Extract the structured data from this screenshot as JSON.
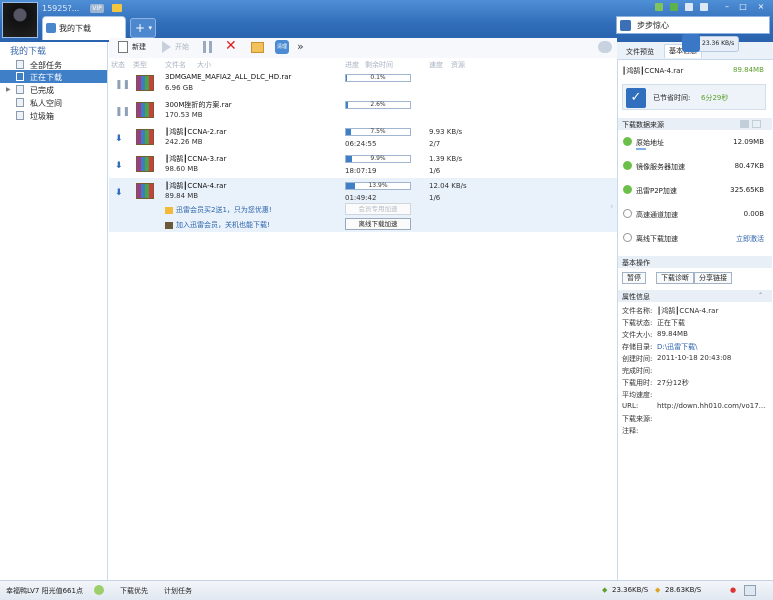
{
  "titlebar": {
    "username": "15925?...",
    "vip": "VIP",
    "tab_label": "我的下载",
    "new_tab": "+",
    "search_text": "步步惊心"
  },
  "sidebar": {
    "title": "我的下载",
    "items": [
      {
        "label": "全部任务"
      },
      {
        "label": "正在下载"
      },
      {
        "label": "已完成"
      },
      {
        "label": "私人空间"
      },
      {
        "label": "垃圾箱"
      }
    ]
  },
  "toolbar": {
    "new": "新建",
    "start": "开始",
    "more": "»",
    "clear_label": "清理"
  },
  "columns": {
    "state": "状态",
    "type": "类型",
    "filename": "文件名",
    "size": "大小",
    "progress": "进度",
    "remaining": "剩余时间",
    "speed": "速度",
    "resource": "资源"
  },
  "tasks": [
    {
      "name": "3DMGAME_MAFIA2_ALL_DLC_HD.rar",
      "size": "6.96 GB",
      "progress_text": "0.1%",
      "progress": 0.001,
      "remaining": "",
      "speed": "",
      "conn": "",
      "state": "paused"
    },
    {
      "name": "300M挫折的方案.rar",
      "size": "170.53 MB",
      "progress_text": "2.6%",
      "progress": 0.026,
      "remaining": "",
      "speed": "",
      "conn": "",
      "state": "paused"
    },
    {
      "name": "┃鸿鹄┃CCNA-2.rar",
      "size": "242.26 MB",
      "progress_text": "7.5%",
      "progress": 0.075,
      "remaining": "06:24:55",
      "speed": "9.93 KB/s",
      "conn": "2/7",
      "state": "downloading"
    },
    {
      "name": "┃鸿鹄┃CCNA-3.rar",
      "size": "98.60 MB",
      "progress_text": "9.9%",
      "progress": 0.099,
      "remaining": "18:07:19",
      "speed": "1.39 KB/s",
      "conn": "1/6",
      "state": "downloading"
    },
    {
      "name": "┃鸿鹄┃CCNA-4.rar",
      "size": "89.84 MB",
      "progress_text": "13.9%",
      "progress": 0.139,
      "remaining": "01:49:42",
      "speed": "12.04 KB/s",
      "conn": "1/6",
      "state": "downloading"
    }
  ],
  "promo": {
    "line1": "迅雷会员买2送1，只为您优惠!",
    "line2": "加入迅雷会员，关机也能下载!",
    "btn_vip_accel": "会员专用加速",
    "btn_offline": "离线下载加速"
  },
  "right_panel": {
    "tab_preview": "文件预览",
    "tab_info": "基本信息",
    "speed_popup": "23.36 KB/s",
    "file_line": "┃鸿鹄┃CCNA-4.rar",
    "file_size": "89.84MB",
    "saved_label": "已节省时间:",
    "saved_value": "6分29秒",
    "sources_title": "下载数据来源",
    "sources": [
      {
        "label": "原始地址",
        "value": "12.09MB",
        "active": true
      },
      {
        "label": "镜像服务器加速",
        "value": "80.47KB",
        "active": true
      },
      {
        "label": "迅雷P2P加速",
        "value": "325.65KB",
        "active": true
      },
      {
        "label": "高速通道加速",
        "value": "0.00B",
        "active": false
      },
      {
        "label": "离线下载加速",
        "value": "立即激活",
        "active": false
      }
    ],
    "ops_title": "基本操作",
    "ops": [
      "暂停",
      "下载诊断",
      "分享链接"
    ],
    "props_title": "属性信息",
    "props": [
      {
        "k": "文件名称:",
        "v": "┃鸿鹄┃CCNA-4.rar"
      },
      {
        "k": "下载状态:",
        "v": "正在下载"
      },
      {
        "k": "文件大小:",
        "v": "89.84MB"
      },
      {
        "k": "存储目录:",
        "v": "D:\\迅雷下载\\"
      },
      {
        "k": "创建时间:",
        "v": "2011-10-18 20:43:08"
      },
      {
        "k": "完成时间:",
        "v": ""
      },
      {
        "k": "下载用时:",
        "v": "27分12秒"
      },
      {
        "k": "平均速度:",
        "v": ""
      },
      {
        "k": "URL:",
        "v": "http://down.hh010.com/vo17..."
      },
      {
        "k": "下载来源:",
        "v": ""
      },
      {
        "k": "注释:",
        "v": ""
      }
    ]
  },
  "status": {
    "level": "幸福鸭LV7 阳光值661点",
    "download_first": "下载优先",
    "plan": "计划任务",
    "down_speed": "23.36KB/S",
    "up_speed": "28.63KB/S"
  }
}
